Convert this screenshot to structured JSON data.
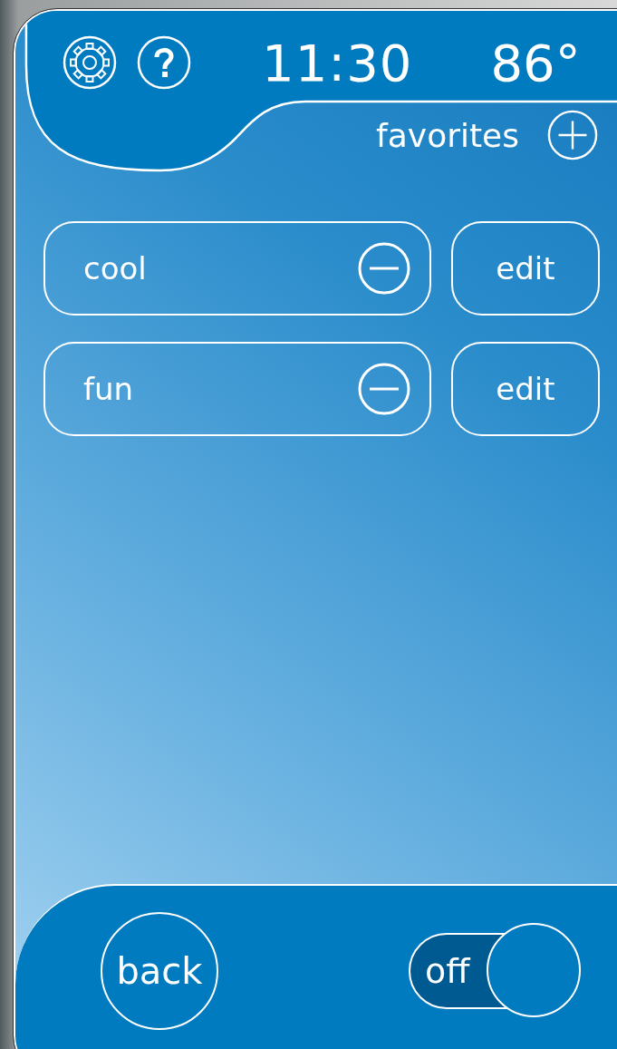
{
  "header": {
    "time": "11:30",
    "temperature": "86°",
    "section_title": "favorites"
  },
  "favorites": [
    {
      "name": "cool",
      "edit_label": "edit"
    },
    {
      "name": "fun",
      "edit_label": "edit"
    }
  ],
  "footer": {
    "back_label": "back",
    "power": {
      "label": "off",
      "on": false
    }
  }
}
